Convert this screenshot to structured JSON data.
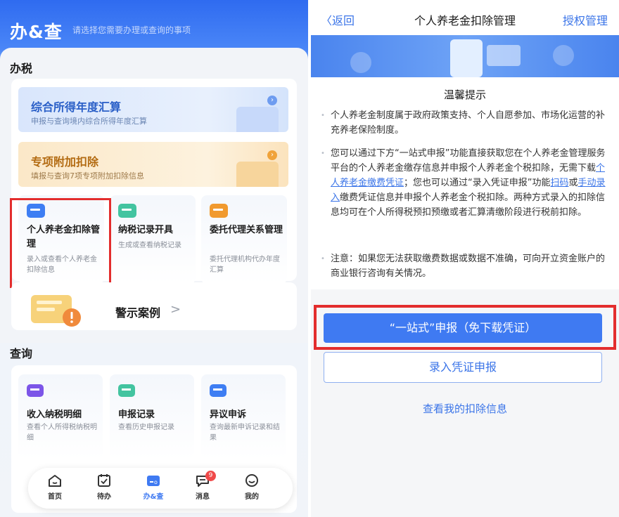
{
  "left": {
    "header": {
      "brand": "办&查",
      "subtitle": "请选择您需要办理或查询的事项"
    },
    "tax_section": {
      "title": "办税",
      "annual": {
        "title": "综合所得年度汇算",
        "desc": "申报与查询境内综合所得年度汇算"
      },
      "special": {
        "title": "专项附加扣除",
        "desc": "填报与查询7项专项附加扣除信息"
      },
      "tiles": [
        {
          "title": "个人养老金扣除管理",
          "desc": "录入或查看个人养老金扣除信息",
          "icon": "pension-card-icon"
        },
        {
          "title": "纳税记录开具",
          "desc": "生成或查看纳税记录",
          "icon": "record-card-icon"
        },
        {
          "title": "委托代理关系管理",
          "desc": "委托代理机构代办年度汇算",
          "icon": "agent-hand-icon"
        }
      ],
      "warning": {
        "label": "警示案例",
        "chevron": ">"
      }
    },
    "query_section": {
      "title": "查询",
      "tiles": [
        {
          "title": "收入纳税明细",
          "desc": "查看个人所得税纳税明细"
        },
        {
          "title": "申报记录",
          "desc": "查看历史申报记录"
        },
        {
          "title": "异议申诉",
          "desc": "查询最新申诉记录和结果"
        }
      ]
    },
    "tabbar": {
      "tabs": [
        {
          "label": "首页"
        },
        {
          "label": "待办"
        },
        {
          "label": "办&查"
        },
        {
          "label": "消息",
          "badge": "9"
        },
        {
          "label": "我的"
        }
      ],
      "active": "办&查"
    }
  },
  "right": {
    "nav": {
      "back": "〈返回",
      "title": "个人养老金扣除管理",
      "action": "授权管理"
    },
    "tips": {
      "title": "温馨提示",
      "p1": "个人养老金制度属于政府政策支持、个人自愿参加、市场化运营的补充养老保险制度。",
      "p2_a": "您可以通过下方“一站式申报”功能直接获取您在个人养老金管理服务平台的个人养老金缴存信息并申报个人养老金个税扣除，无需下载",
      "p2_link1": "个人养老金缴费凭证",
      "p2_b": "；您也可以通过“录入凭证申报”功能",
      "p2_link2": "扫码",
      "p2_c": "或",
      "p2_link3": "手动录入",
      "p2_d": "缴费凭证信息并申报个人养老金个税扣除。两种方式录入的扣除信息均可在个人所得税预扣预缴或者汇算清缴阶段进行税前扣除。",
      "p3": "注意：如果您无法获取缴费数据或数据不准确，可向开立资金账户的商业银行咨询有关情况。"
    },
    "buttons": {
      "one_stop": "“一站式”申报（免下载凭证）",
      "voucher": "录入凭证申报",
      "view": "查看我的扣除信息"
    }
  },
  "colors": {
    "accent": "#3f7af2",
    "highlight": "#e32d2d",
    "link": "#3a74e8"
  }
}
